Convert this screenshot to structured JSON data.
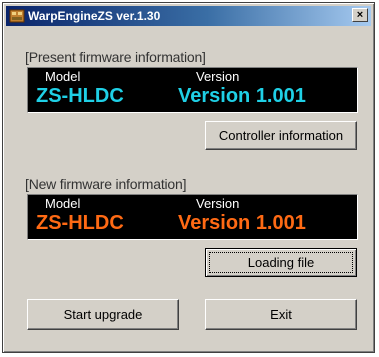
{
  "window": {
    "title": "WarpEngineZS ver.1.30",
    "close_label": "×"
  },
  "present": {
    "group_label": "[Present firmware information]",
    "model_caption": "Model",
    "version_caption": "Version",
    "model_value": "ZS-HLDC",
    "version_value": "Version 1.001",
    "value_color": "#1fd0e6"
  },
  "new": {
    "group_label": "[New firmware information]",
    "model_caption": "Model",
    "version_caption": "Version",
    "model_value": "ZS-HLDC",
    "version_value": "Version 1.001",
    "value_color": "#ff6a14"
  },
  "buttons": {
    "controller_info": "Controller information",
    "loading_file": "Loading file",
    "start_upgrade": "Start upgrade",
    "exit": "Exit"
  },
  "colors": {
    "titlebar_start": "#0a246a",
    "titlebar_end": "#a6caf0",
    "dialog_face": "#d4d0c8",
    "display_bg": "#000000"
  }
}
